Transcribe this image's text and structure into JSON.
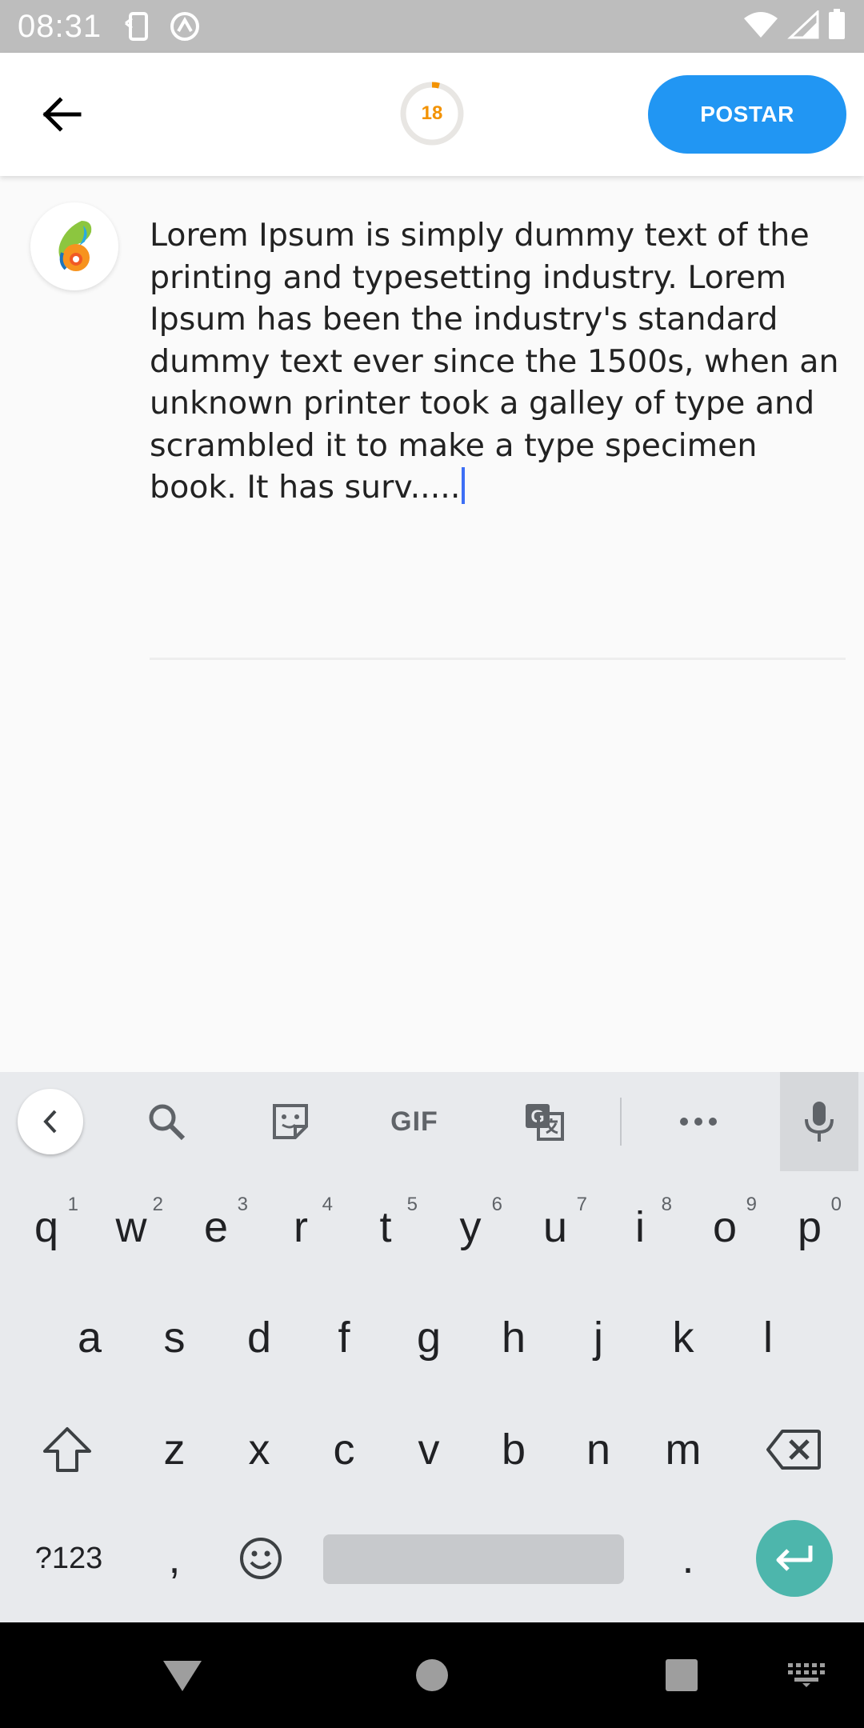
{
  "status_bar": {
    "time": "08:31",
    "icons": [
      "screen-rotate-icon",
      "vpn-icon",
      "wifi-icon",
      "signal-icon",
      "battery-icon"
    ]
  },
  "app_bar": {
    "back_icon": "arrow-back-icon",
    "char_counter": "18",
    "counter_progress": 0.04,
    "post_button_label": "POSTAR"
  },
  "compose": {
    "avatar": "app-logo-avatar",
    "text": "Lorem Ipsum is simply dummy text of the printing and typesetting industry. Lorem Ipsum has been the industry's standard dummy text ever since the 1500s, when an unknown printer took a galley of type and scrambled it to make a type specimen book. It has surv....."
  },
  "keyboard": {
    "toolbar": {
      "collapse_icon": "chevron-left-icon",
      "search_icon": "search-icon",
      "sticker_icon": "sticker-icon",
      "gif_label": "GIF",
      "translate_icon": "translate-icon",
      "more_icon": "more-horiz-icon",
      "mic_icon": "mic-icon"
    },
    "row1": [
      {
        "key": "q",
        "hint": "1"
      },
      {
        "key": "w",
        "hint": "2"
      },
      {
        "key": "e",
        "hint": "3"
      },
      {
        "key": "r",
        "hint": "4"
      },
      {
        "key": "t",
        "hint": "5"
      },
      {
        "key": "y",
        "hint": "6"
      },
      {
        "key": "u",
        "hint": "7"
      },
      {
        "key": "i",
        "hint": "8"
      },
      {
        "key": "o",
        "hint": "9"
      },
      {
        "key": "p",
        "hint": "0"
      }
    ],
    "row2": [
      "a",
      "s",
      "d",
      "f",
      "g",
      "h",
      "j",
      "k",
      "l"
    ],
    "row3": [
      "z",
      "x",
      "c",
      "v",
      "b",
      "n",
      "m"
    ],
    "symbols_label": "?123",
    "comma": ",",
    "period": ".",
    "shift_icon": "shift-icon",
    "backspace_icon": "backspace-icon",
    "emoji_icon": "emoji-icon",
    "enter_icon": "enter-icon"
  },
  "nav_bar": {
    "back_icon": "nav-back-icon",
    "home_icon": "nav-home-icon",
    "recents_icon": "nav-recents-icon",
    "keyboard_switch_icon": "keyboard-switch-icon"
  },
  "colors": {
    "accent": "#2196f3",
    "counter": "#f39200",
    "enter": "#4db6ac",
    "caret": "#3d6ff5"
  }
}
